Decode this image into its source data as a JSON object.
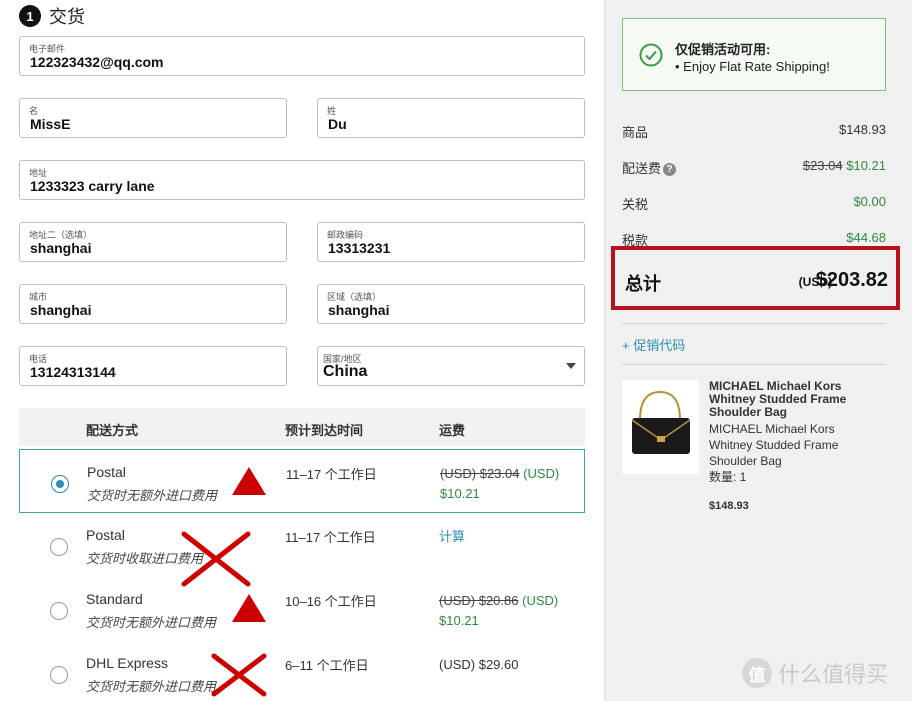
{
  "step": {
    "number": "1",
    "title": "交货"
  },
  "form": {
    "email": {
      "label": "电子邮件",
      "value": "122323432@qq.com"
    },
    "first_name": {
      "label": "名",
      "value": "MissE"
    },
    "last_name": {
      "label": "姓",
      "value": "Du"
    },
    "address": {
      "label": "地址",
      "value": "1233323 carry lane"
    },
    "address2": {
      "label": "地址二（选填）",
      "value": "shanghai"
    },
    "postcode": {
      "label": "邮政编码",
      "value": "13313231"
    },
    "city": {
      "label": "城市",
      "value": "shanghai"
    },
    "region": {
      "label": "区域（选填）",
      "value": "shanghai"
    },
    "phone": {
      "label": "电话",
      "value": "13124313144"
    },
    "country": {
      "label": "国家/地区",
      "value": "China"
    }
  },
  "shipping": {
    "headers": {
      "method": "配送方式",
      "eta": "预计到达时间",
      "fee": "运费"
    },
    "options": [
      {
        "name": "Postal",
        "note": "交货时无额外进口费用",
        "eta": "11–17 个工作日",
        "fee_old": "(USD) $23.04",
        "fee_cur": "(USD)",
        "fee_new": "$10.21",
        "selected": true
      },
      {
        "name": "Postal",
        "note": "交货时收取进口费用",
        "eta": "11–17 个工作日",
        "fee_link": "计算",
        "selected": false
      },
      {
        "name": "Standard",
        "note": "交货时无额外进口费用",
        "eta": "10–16 个工作日",
        "fee_old": "(USD) $20.86",
        "fee_cur": "(USD)",
        "fee_new": "$10.21",
        "selected": false
      },
      {
        "name": "DHL Express",
        "note": "交货时无额外进口费用",
        "eta": "6–11 个工作日",
        "fee_plain": "(USD) $29.60",
        "selected": false
      }
    ]
  },
  "summary": {
    "promo": {
      "title": "仅促销活动可用:",
      "item": "•  Enjoy Flat Rate Shipping!"
    },
    "items_label": "商品",
    "items_value": "$148.93",
    "shipping_label": "配送费",
    "shipping_old": "$23.04",
    "shipping_new": "$10.21",
    "duty_label": "关税",
    "duty_value": "$0.00",
    "tax_label": "税款",
    "tax_value": "$44.68",
    "total_label": "总计",
    "total_currency": "(USD)",
    "total_value": "$203.82",
    "promo_code_link": "+ 促销代码"
  },
  "product": {
    "brand_title": "MICHAEL Michael Kors Whitney Studded Frame Shoulder Bag",
    "description": "MICHAEL Michael Kors Whitney Studded Frame Shoulder Bag",
    "qty": "数量: 1",
    "price": "$148.93"
  },
  "watermark": {
    "badge": "值",
    "text": "什么值得买"
  },
  "colors": {
    "accent": "#2b8fb8",
    "green": "#2e8b3e",
    "highlight": "#b5121b"
  }
}
